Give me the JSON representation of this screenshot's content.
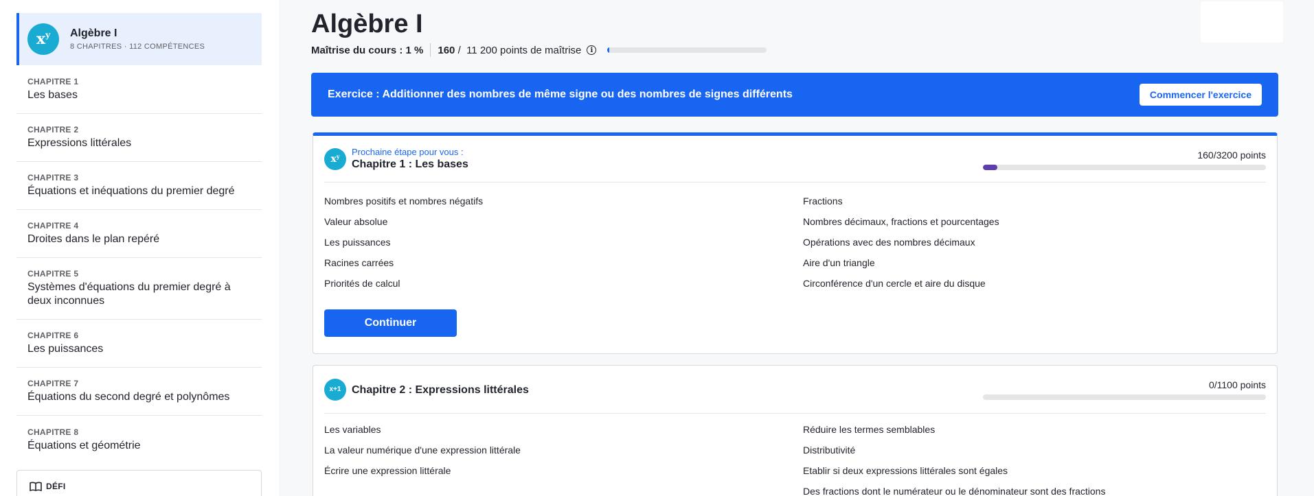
{
  "sidebar": {
    "course": {
      "title": "Algèbre I",
      "subtitle": "8 CHAPITRES · 112 COMPÉTENCES"
    },
    "chapters": [
      {
        "label": "CHAPITRE 1",
        "title": "Les bases"
      },
      {
        "label": "CHAPITRE 2",
        "title": "Expressions littérales"
      },
      {
        "label": "CHAPITRE 3",
        "title": "Équations et inéquations du premier degré"
      },
      {
        "label": "CHAPITRE 4",
        "title": "Droites dans le plan repéré"
      },
      {
        "label": "CHAPITRE 5",
        "title": "Systèmes d'équations du premier degré à deux inconnues"
      },
      {
        "label": "CHAPITRE 6",
        "title": "Les puissances"
      },
      {
        "label": "CHAPITRE 7",
        "title": "Équations du second degré et polynômes"
      },
      {
        "label": "CHAPITRE 8",
        "title": "Équations et géométrie"
      }
    ],
    "challenge_label": "DÉFI"
  },
  "header": {
    "title": "Algèbre I",
    "mastery_label": "Maîtrise du cours : 1 %",
    "points_current": "160",
    "points_rest": " /  11 200 points de maîtrise",
    "mastery_percent": 1
  },
  "exercise": {
    "text": "Exercice : Additionner des nombres de même signe ou des nombres de signes différents",
    "button": "Commencer l'exercice"
  },
  "cards": [
    {
      "next_step": "Prochaine étape pour vous :",
      "title": "Chapitre 1 : Les bases",
      "points": "160/3200 points",
      "progress_fraction": 0.05,
      "skills_left": [
        "Nombres positifs et nombres négatifs",
        "Valeur absolue",
        "Les puissances",
        "Racines carrées",
        "Priorités de calcul"
      ],
      "skills_right": [
        "Fractions",
        "Nombres décimaux, fractions et pourcentages",
        "Opérations avec des nombres décimaux",
        "Aire d'un triangle",
        "Circonférence d'un cercle et aire du disque"
      ],
      "button": "Continuer"
    },
    {
      "icon_text": "x+1",
      "title": "Chapitre 2 : Expressions littérales",
      "points": "0/1100 points",
      "progress_fraction": 0,
      "skills_left": [
        "Les variables",
        "La valeur numérique d'une expression littérale",
        "Écrire une expression littérale"
      ],
      "skills_right": [
        "Réduire les termes semblables",
        "Distributivité",
        "Etablir si deux expressions littérales sont égales",
        "Des fractions dont le numérateur ou le dénominateur sont des fractions"
      ]
    }
  ],
  "colors": {
    "accent": "#1865f2",
    "course_icon": "#1aabd3",
    "progress": "#5e3fa9"
  }
}
